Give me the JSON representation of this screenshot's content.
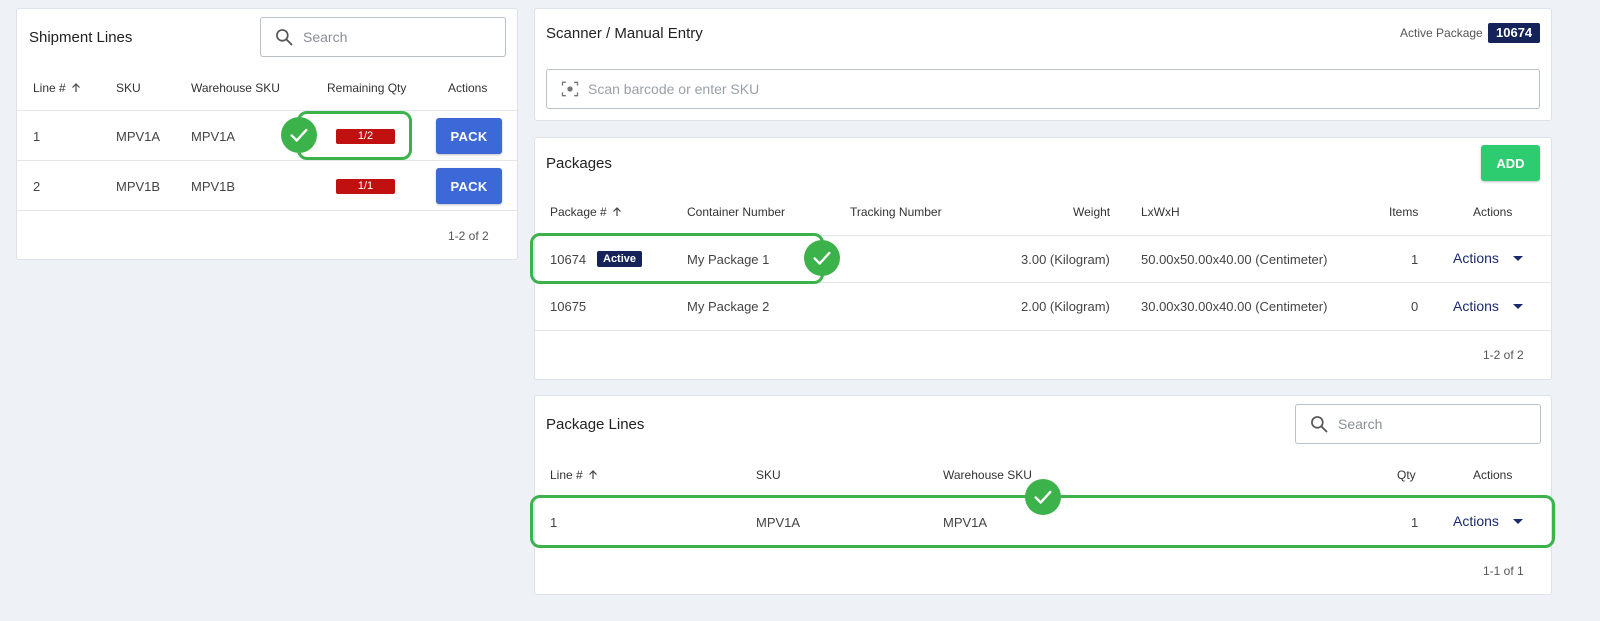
{
  "shipment_lines": {
    "title": "Shipment Lines",
    "search_placeholder": "Search",
    "columns": [
      "Line #",
      "SKU",
      "Warehouse SKU",
      "Remaining Qty",
      "Actions"
    ],
    "rows": [
      {
        "line": "1",
        "sku": "MPV1A",
        "warehouse_sku": "MPV1A",
        "remaining": "1/2",
        "action": "PACK"
      },
      {
        "line": "2",
        "sku": "MPV1B",
        "warehouse_sku": "MPV1B",
        "remaining": "1/1",
        "action": "PACK"
      }
    ],
    "pagination": "1-2 of 2"
  },
  "scanner": {
    "title": "Scanner / Manual Entry",
    "active_package_label": "Active Package",
    "active_package_id": "10674",
    "input_placeholder": "Scan barcode or enter SKU"
  },
  "packages": {
    "title": "Packages",
    "add_label": "ADD",
    "columns": [
      "Package #",
      "Container Number",
      "Tracking Number",
      "Weight",
      "LxWxH",
      "Items",
      "Actions"
    ],
    "rows": [
      {
        "package": "10674",
        "status": "Active",
        "container": "My Package 1",
        "tracking": "",
        "weight": "3.00 (Kilogram)",
        "dims": "50.00x50.00x40.00 (Centimeter)",
        "items": "1",
        "action": "Actions"
      },
      {
        "package": "10675",
        "status": "",
        "container": "My Package 2",
        "tracking": "",
        "weight": "2.00 (Kilogram)",
        "dims": "30.00x30.00x40.00 (Centimeter)",
        "items": "0",
        "action": "Actions"
      }
    ],
    "pagination": "1-2 of 2"
  },
  "package_lines": {
    "title": "Package Lines",
    "search_placeholder": "Search",
    "columns": [
      "Line #",
      "SKU",
      "Warehouse SKU",
      "Qty",
      "Actions"
    ],
    "rows": [
      {
        "line": "1",
        "sku": "MPV1A",
        "warehouse_sku": "MPV1A",
        "qty": "1",
        "action": "Actions"
      }
    ],
    "pagination": "1-1 of 1"
  },
  "colors": {
    "primary_button": "#3c68d8",
    "add_button": "#2ecc71",
    "badge_red": "#c01010",
    "navy": "#15235a",
    "highlight_green": "#3cb34a"
  },
  "icons": [
    "search-icon",
    "sort-arrow-up-icon",
    "scan-icon",
    "check-icon",
    "caret-down-icon"
  ]
}
